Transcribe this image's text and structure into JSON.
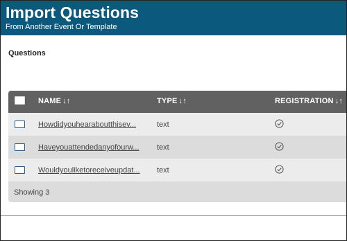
{
  "header": {
    "title": "Import Questions",
    "subtitle": "From Another Event Or Template"
  },
  "section": {
    "label": "Questions"
  },
  "table": {
    "columns": [
      {
        "label": "NAME",
        "sort_icon": "↓↑"
      },
      {
        "label": "TYPE",
        "sort_icon": "↓↑"
      },
      {
        "label": "REGISTRATION",
        "sort_icon": "↓↑"
      }
    ],
    "rows": [
      {
        "name": "Howdidyouhearaboutthisev...",
        "type": "text",
        "registration": true
      },
      {
        "name": "Haveyouattendedanyofourw...",
        "type": "text",
        "registration": true
      },
      {
        "name": "Wouldyouliketoreceiveupdat...",
        "type": "text",
        "registration": true
      }
    ],
    "footer": "Showing 3"
  },
  "colors": {
    "header_bg": "#0b5a7e",
    "table_header_bg": "#616161"
  }
}
